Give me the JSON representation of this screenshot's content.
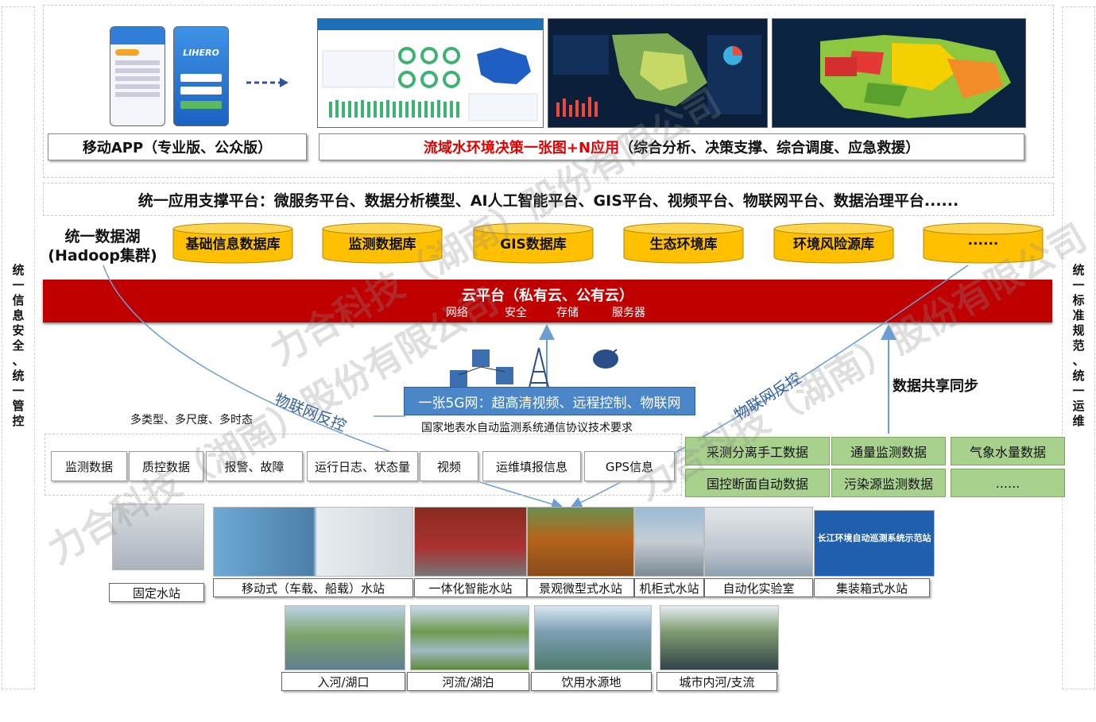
{
  "left_side": [
    "统",
    "一",
    "信",
    "息",
    "安",
    "全",
    "、",
    "统",
    "一",
    "管",
    "控"
  ],
  "right_side": [
    "统",
    "一",
    "标",
    "准",
    "规",
    "范",
    "、",
    "统",
    "一",
    "运",
    "维"
  ],
  "top": {
    "mobile_app_label": "移动APP（专业版、公众版）",
    "decision_red": "流域水环境决策一张图+N应用",
    "decision_black": "（综合分析、决策支撑、综合调度、应急救援）",
    "phone_brand": "LIHERO"
  },
  "support_platform": "统一应用支撑平台：微服务平台、数据分析模型、AI人工智能平台、GIS平台、视频平台、物联网平台、数据治理平台......",
  "data_lake": {
    "line1": "统一数据湖",
    "line2": "(Hadoop集群)"
  },
  "databases": [
    "基础信息数据库",
    "监测数据库",
    "GIS数据库",
    "生态环境库",
    "环境风险源库",
    "......"
  ],
  "cloud": {
    "title": "云平台（私有云、公有云）",
    "items": [
      "网络",
      "安全",
      "存储",
      "服务器"
    ]
  },
  "network": {
    "fiveg": "一张5G网：超高清视频、远程控制、物联网",
    "protocol": "国家地表水自动监测系统通信协议技术要求",
    "multi": "多类型、多尺度、多时态",
    "iot_left": "物联网反控",
    "iot_right": "物联网反控",
    "share": "数据共享同步"
  },
  "data_types": [
    "监测数据",
    "质控数据",
    "报警、故障",
    "运行日志、状态量",
    "视频",
    "运维填报信息",
    "GPS信息"
  ],
  "green_data": [
    "采测分离手工数据",
    "通量监测数据",
    "气象水量数据",
    "国控断面自动数据",
    "污染源监测数据",
    "......"
  ],
  "stations": [
    "固定水站",
    "移动式（车载、船载）水站",
    "一体化智能水站",
    "景观微型式水站",
    "机柜式水站",
    "自动化实验室",
    "集装箱式水站"
  ],
  "container_text": "长江环境自动巡测系统示范站",
  "water_bodies": [
    "入河/湖口",
    "河流/湖泊",
    "饮用水源地",
    "城市内河/支流"
  ],
  "watermark": [
    "力合科技（湖南）股份有限公司",
    "力合科技（湖南）股份有限公司",
    "力合科技（湖南）股份有限公司"
  ],
  "colors": {
    "cloud_red": "#c00000",
    "db_orange": "#ffc000",
    "green": "#a9d18e",
    "blue_5g": "#4a86c8",
    "arrow_blue": "#6a9fd4"
  }
}
